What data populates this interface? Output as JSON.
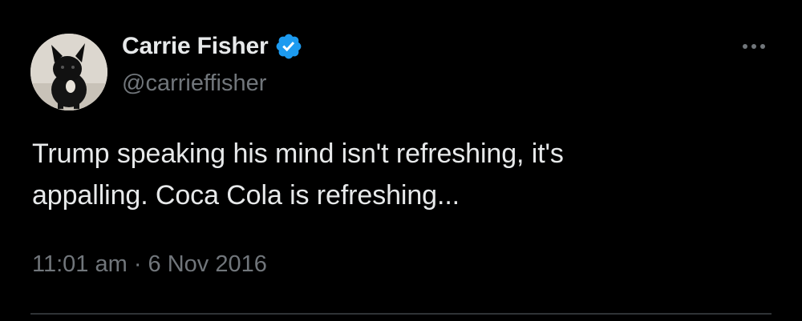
{
  "tweet": {
    "author": {
      "display_name": "Carrie Fisher",
      "handle": "@carrieffisher",
      "verified": true,
      "verified_icon": "verified-badge-icon",
      "avatar": "dog-avatar"
    },
    "more_icon": "more-options-icon",
    "text_lines": [
      "Trump speaking his mind isn't refreshing, it's",
      "appalling. Coca Cola is refreshing..."
    ],
    "timestamp": "11:01 am · 6 Nov 2016"
  },
  "colors": {
    "background": "#000000",
    "primary_text": "#e7e9ea",
    "secondary_text": "#71767b",
    "verified_badge": "#1d9bf0",
    "divider": "#2f3336"
  }
}
